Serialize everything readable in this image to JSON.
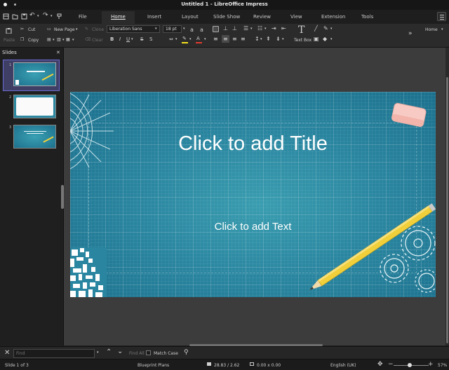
{
  "window": {
    "title": "Untitled 1 - LibreOffice Impress"
  },
  "menu_tabs": [
    {
      "label": "File"
    },
    {
      "label": "Home"
    },
    {
      "label": "Insert"
    },
    {
      "label": "Layout"
    },
    {
      "label": "Slide Show"
    },
    {
      "label": "Review"
    },
    {
      "label": "View"
    },
    {
      "label": "Extension"
    },
    {
      "label": "Tools"
    }
  ],
  "ribbon": {
    "cut": "Cut",
    "copy": "Copy",
    "paste": "Paste",
    "new_page": "New Page",
    "clone": "Clone",
    "clear": "Clear",
    "font_name": "Liberation Sans",
    "font_size": "18 pt",
    "text_box": "Text Box",
    "tab_selector": "Home"
  },
  "slides_pane": {
    "title": "Slides",
    "numbers": [
      "1",
      "2",
      "3"
    ]
  },
  "slide": {
    "title_placeholder": "Click to add Title",
    "text_placeholder": "Click to add Text"
  },
  "findbar": {
    "placeholder": "Find",
    "find_all": "Find All",
    "match_case": "Match Case"
  },
  "statusbar": {
    "slide_info": "Slide 1 of 3",
    "master": "Blueprint Plans",
    "position": "28.83 / 2.62",
    "size": "0.00 x 0.00",
    "language": "English (UK)",
    "zoom": "57%"
  },
  "colors": {
    "accent": "#6b6bd4",
    "slide_bg": "#2a86a0",
    "pencil": "#f0cf3a",
    "eraser": "#f7c9c4"
  }
}
